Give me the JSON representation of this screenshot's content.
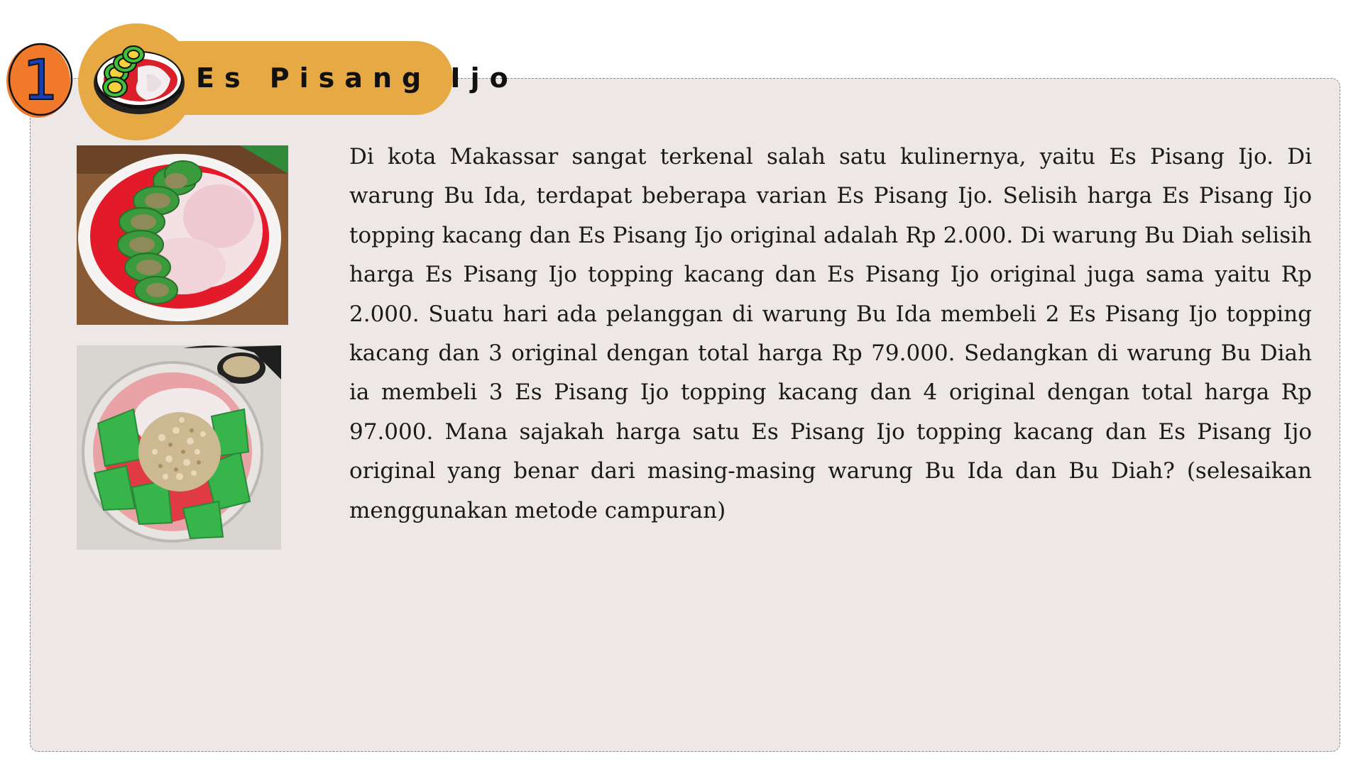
{
  "header": {
    "number": "1",
    "title": "Es Pisang Ijo"
  },
  "icons": {
    "number_badge": "number-one-badge-icon",
    "title_icon": "es-pisang-ijo-bowl-icon"
  },
  "colors": {
    "badge_orange": "#f07a2a",
    "title_pill": "#e6a944",
    "card_background": "#ede8e5",
    "text": "#1a1a1a"
  },
  "problem": {
    "text": "Di kota Makassar sangat terkenal salah satu kulinernya, yaitu Es Pisang Ijo. Di warung Bu Ida, terdapat beberapa varian Es Pisang Ijo. Selisih harga Es Pisang Ijo topping kacang dan Es Pisang Ijo original adalah Rp 2.000. Di warung Bu Diah selisih harga Es Pisang Ijo topping kacang dan Es Pisang Ijo original juga sama yaitu Rp 2.000. Suatu hari ada pelanggan di warung Bu Ida membeli 2 Es Pisang Ijo topping kacang dan 3 original dengan total harga Rp 79.000. Sedangkan di warung Bu Diah ia membeli 3 Es Pisang Ijo topping kacang dan 4 original dengan total harga Rp 97.000. Mana sajakah harga satu Es Pisang Ijo topping kacang dan Es Pisang Ijo original yang benar dari masing-masing warung Bu Ida dan Bu Diah? (selesaikan menggunakan metode campuran)"
  }
}
